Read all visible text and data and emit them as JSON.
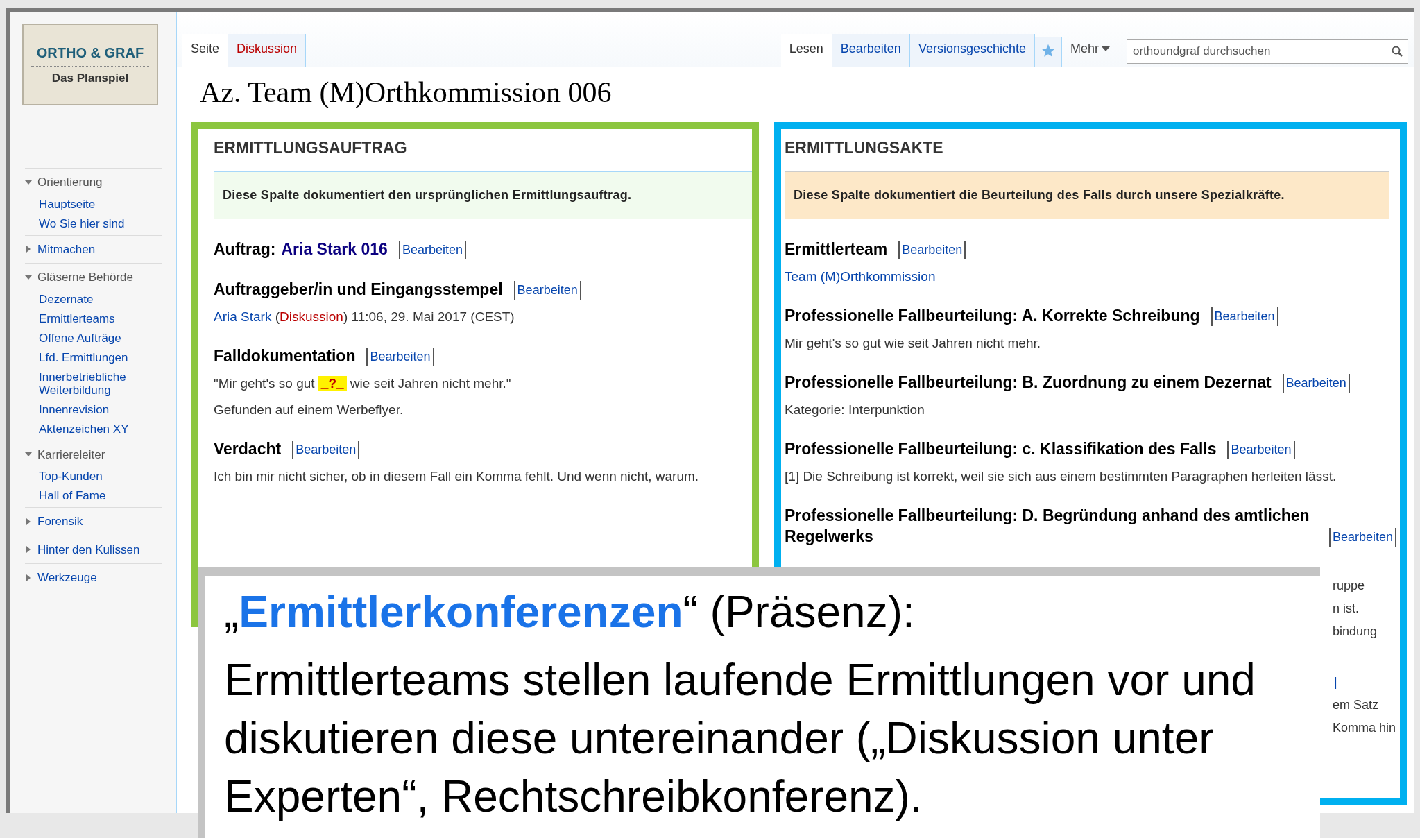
{
  "logo": {
    "title": "ORTHO & GRAF",
    "subtitle": "Das Planspiel"
  },
  "sidebar": [
    {
      "heading": "Orientierung",
      "expanded": true,
      "items": [
        "Hauptseite",
        "Wo Sie hier sind"
      ]
    },
    {
      "heading": "Mitmachen",
      "expanded": false
    },
    {
      "heading": "Gläserne Behörde",
      "expanded": true,
      "items": [
        "Dezernate",
        "Ermittlerteams",
        "Offene Aufträge",
        "Lfd. Ermittlungen",
        "Innerbetriebliche Weiterbildung",
        "Innenrevision",
        "Aktenzeichen XY"
      ]
    },
    {
      "heading": "Karriereleiter",
      "expanded": true,
      "items": [
        "Top-Kunden",
        "Hall of Fame"
      ]
    },
    {
      "heading": "Forensik",
      "expanded": false
    },
    {
      "heading": "Hinter den Kulissen",
      "expanded": false
    },
    {
      "heading": "Werkzeuge",
      "expanded": false
    }
  ],
  "left_tabs": [
    {
      "label": "Seite",
      "selected": true,
      "missing": false
    },
    {
      "label": "Diskussion",
      "selected": false,
      "missing": true
    }
  ],
  "right_tabs": [
    {
      "kind": "text",
      "label": "Lesen",
      "selected": true
    },
    {
      "kind": "text",
      "label": "Bearbeiten",
      "selected": false
    },
    {
      "kind": "text",
      "label": "Versionsgeschichte",
      "selected": false
    },
    {
      "kind": "star",
      "selected": false
    },
    {
      "kind": "menu",
      "label": "Mehr",
      "selected": false
    }
  ],
  "search": {
    "placeholder": "orthoundgraf durchsuchen"
  },
  "page_title": "Az. Team (M)Orthkommission 006",
  "left_column": {
    "title": "ERMITTLUNGSAUFTRAG",
    "notice": "Diese Spalte dokumentiert den ursprünglichen Ermittlungsauftrag.",
    "sections": [
      {
        "heading": "Auftrag:",
        "heading_link": "Aria Stark 016",
        "edit": "Bearbeiten"
      },
      {
        "heading": "Auftraggeber/in und Eingangsstempel",
        "edit": "Bearbeiten",
        "lines": [
          [
            {
              "kind": "link",
              "text": "Aria Stark"
            },
            {
              "kind": "plain",
              "text": " ("
            },
            {
              "kind": "redlink",
              "text": "Diskussion"
            },
            {
              "kind": "plain",
              "text": ") 11:06, 29. Mai 2017 (CEST)"
            }
          ]
        ]
      },
      {
        "heading": "Falldokumentation",
        "edit": "Bearbeiten",
        "lines": [
          [
            {
              "kind": "plain",
              "text": "\"Mir geht's so gut "
            },
            {
              "kind": "gap",
              "text": "_?_"
            },
            {
              "kind": "plain",
              "text": " wie seit Jahren nicht mehr.\""
            }
          ],
          [
            {
              "kind": "plain",
              "text": "Gefunden auf einem Werbeflyer."
            }
          ]
        ]
      },
      {
        "heading": "Verdacht",
        "edit": "Bearbeiten",
        "lines": [
          [
            {
              "kind": "plain",
              "text": "Ich bin mir nicht sicher, ob in diesem Fall ein Komma fehlt. Und wenn nicht, warum."
            }
          ]
        ]
      }
    ]
  },
  "right_column": {
    "title": "ERMITTLUNGSAKTE",
    "notice": "Diese Spalte dokumentiert die Beurteilung des Falls durch unsere Spezialkräfte.",
    "sections": [
      {
        "heading": "Ermittlerteam",
        "edit": "Bearbeiten",
        "lines": [
          [
            {
              "kind": "link",
              "text": "Team (M)Orthkommission"
            }
          ]
        ]
      },
      {
        "heading": "Professionelle Fallbeurteilung: A. Korrekte Schreibung",
        "edit": "Bearbeiten",
        "lines": [
          [
            {
              "kind": "plain",
              "text": "Mir geht's so gut wie seit Jahren nicht mehr."
            }
          ]
        ]
      },
      {
        "heading": "Professionelle Fallbeurteilung: B. Zuordnung zu einem Dezernat",
        "edit": "Bearbeiten",
        "lines": [
          [
            {
              "kind": "plain",
              "text": "Kategorie: Interpunktion"
            }
          ]
        ]
      },
      {
        "heading": "Professionelle Fallbeurteilung: c. Klassifikation des Falls",
        "edit": "Bearbeiten",
        "lines": [
          [
            {
              "kind": "plain",
              "text": "[1] Die Schreibung ist korrekt, weil sie sich aus einem bestimmten Paragraphen herleiten lässt."
            }
          ]
        ]
      },
      {
        "heading": "Professionelle Fallbeurteilung: D. Begründung anhand des amtlichen Regelwerks",
        "edit": "Bearbeiten"
      }
    ],
    "fragments": [
      {
        "kind": "plain",
        "text": "ruppe"
      },
      {
        "kind": "plain",
        "text": "n ist."
      },
      {
        "kind": "plain",
        "text": "bindung"
      },
      {
        "kind": "spacer"
      },
      {
        "kind": "link",
        "text": "|"
      },
      {
        "kind": "plain",
        "text": "em Satz"
      },
      {
        "kind": "plain",
        "text": "Komma hin"
      }
    ]
  },
  "overlay": {
    "title_before": "„",
    "title_highlight": "Ermittlerkonferenzen",
    "title_after": "“ (Präsenz):",
    "body": "Ermittlerteams stellen laufende Ermittlungen vor und diskutieren diese untereinander („Diskussion unter Experten“, Rechtschreibkonferenz)."
  }
}
